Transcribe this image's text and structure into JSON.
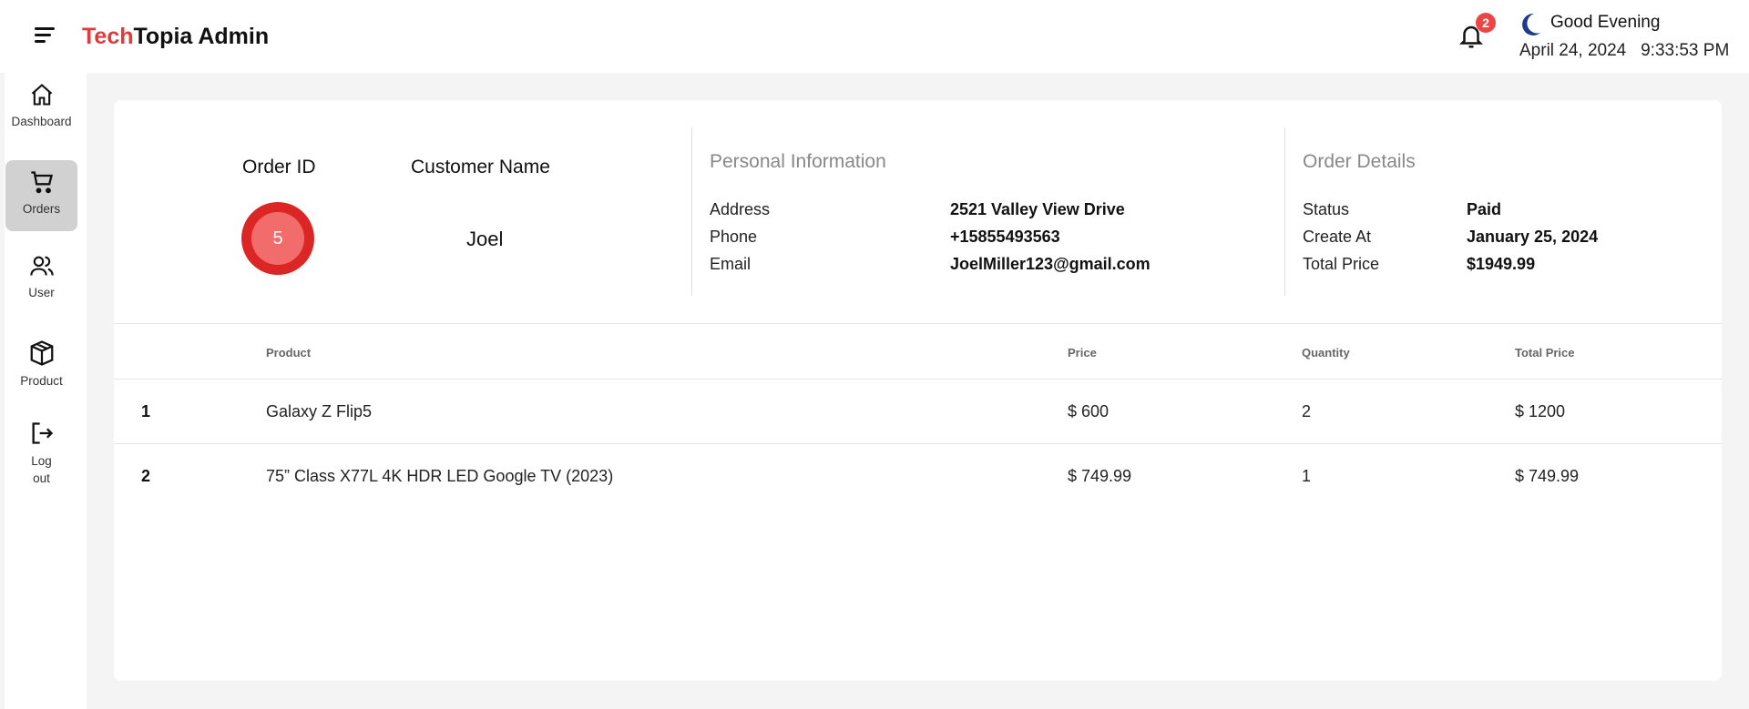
{
  "header": {
    "brand_accent": "Tech",
    "brand_rest": "Topia Admin",
    "notification_count": "2",
    "greeting": "Good Evening",
    "date": "April 24, 2024",
    "time": "9:33:53 PM"
  },
  "sidebar": {
    "items": [
      {
        "label": "Dashboard",
        "icon": "home-icon"
      },
      {
        "label": "Orders",
        "icon": "cart-icon",
        "active": true
      },
      {
        "label": "User",
        "icon": "users-icon"
      },
      {
        "label": "Product",
        "icon": "box-icon"
      },
      {
        "label": "Log out",
        "icon": "logout-icon"
      }
    ]
  },
  "order": {
    "order_id_label": "Order ID",
    "order_id": "5",
    "customer_label": "Customer Name",
    "customer": "Joel"
  },
  "personal": {
    "title": "Personal Information",
    "address_label": "Address",
    "address": "2521 Valley View Drive",
    "phone_label": "Phone",
    "phone": "+15855493563",
    "email_label": "Email",
    "email": "JoelMiller123@gmail.com"
  },
  "details": {
    "title": "Order Details",
    "status_label": "Status",
    "status": "Paid",
    "created_label": "Create At",
    "created": "January 25, 2024",
    "total_label": "Total Price",
    "total": "$1949.99"
  },
  "table": {
    "headers": [
      "Product",
      "Price",
      "Quantity",
      "Total Price"
    ],
    "rows": [
      {
        "n": "1",
        "product": "Galaxy Z Flip5",
        "price": "$ 600",
        "qty": "2",
        "total": "$ 1200"
      },
      {
        "n": "2",
        "product": "75” Class X77L 4K HDR LED Google TV (2023)",
        "price": "$ 749.99",
        "qty": "1",
        "total": "$ 749.99"
      }
    ]
  },
  "colors": {
    "accent": "#e03a3a",
    "badge": "#ef4444",
    "moon": "#1e3a8a"
  }
}
